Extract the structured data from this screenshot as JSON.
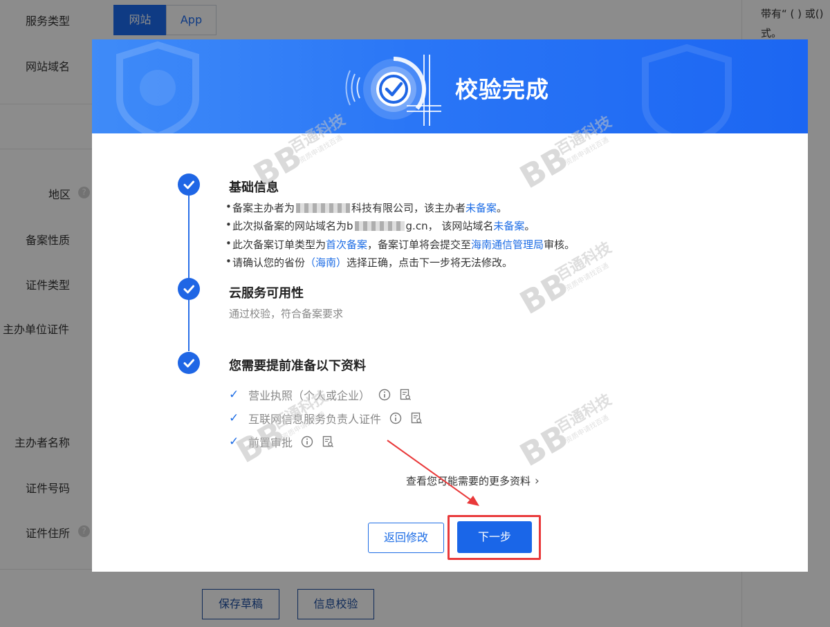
{
  "background": {
    "labels": {
      "service_type": "服务类型",
      "site_domain": "网站域名",
      "region": "地区",
      "record_nature": "备案性质",
      "cert_type": "证件类型",
      "org_cert": "主办单位证件",
      "sponsor_name": "主办者名称",
      "cert_number": "证件号码",
      "cert_address": "证件住所"
    },
    "service_tabs": {
      "website": "网站",
      "app": "App"
    },
    "help_glyph": "?",
    "side_note_line1": "带有“ ( ) 或()",
    "side_note_line2": "式。",
    "buttons": {
      "save_draft": "保存草稿",
      "verify": "信息校验"
    }
  },
  "dialog": {
    "title": "校验完成",
    "step1": {
      "title": "基础信息",
      "b1_prefix": "备案主办者为",
      "b1_mid": "科技有限公司，该主办者",
      "b1_link": "未备案",
      "b1_end": "。",
      "b2_prefix": "此次拟备案的网站域名为b",
      "b2_mid": "g.cn， 该网站域名",
      "b2_link": "未备案",
      "b2_end": "。",
      "b3_prefix": "此次备案订单类型为",
      "b3_link1": "首次备案",
      "b3_mid": "，备案订单将会提交至",
      "b3_link2": "海南通信管理局",
      "b3_end": "审核。",
      "b4_prefix": "请确认您的省份",
      "b4_link": "（海南）",
      "b4_end": "选择正确，点击下一步将无法修改。"
    },
    "step2": {
      "title": "云服务可用性",
      "desc": "通过校验，符合备案要求"
    },
    "step3": {
      "title": "您需要提前准备以下资料",
      "check_glyph": "✓",
      "items": [
        {
          "label": "营业执照（个人或企业）"
        },
        {
          "label": "互联网信息服务负责人证件"
        },
        {
          "label": "前置审批"
        }
      ]
    },
    "more_link": "查看您可能需要的更多资料",
    "more_chevron": "›",
    "back_button": "返回修改",
    "next_button": "下一步"
  },
  "watermark": {
    "brand": "百通科技",
    "tagline": "资质申请找百通",
    "logo_text": "BB"
  },
  "colors": {
    "primary": "#1c6ce5",
    "header": "#2a76f6",
    "highlight": "#e9393a"
  }
}
